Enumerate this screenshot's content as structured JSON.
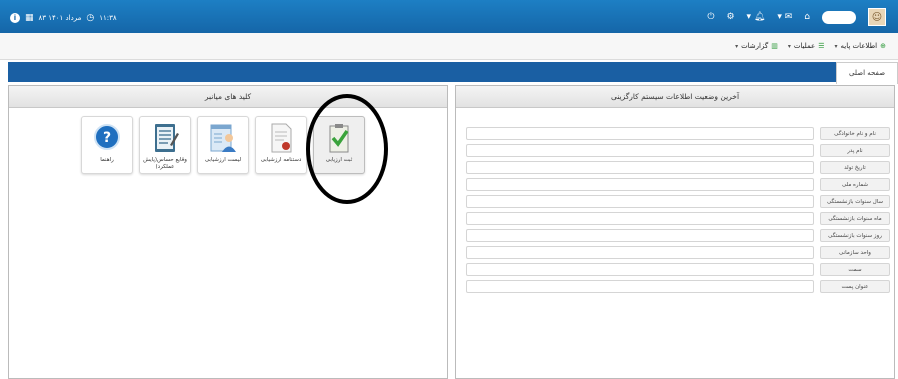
{
  "topbar": {
    "date_text": "۸۳ مرداد ۱۴۰۱",
    "time_text": "۱۱:۳۸",
    "icons": [
      "info-icon",
      "calendar-icon",
      "clock-icon",
      "home-icon",
      "mail-icon",
      "bell-icon",
      "gear-icon",
      "power-icon"
    ]
  },
  "menu": {
    "items": [
      {
        "label": "اطلاعات پایه",
        "icon": "plus-circle-icon"
      },
      {
        "label": "عملیات",
        "icon": "list-icon"
      },
      {
        "label": "گزارشات",
        "icon": "bar-chart-icon"
      }
    ]
  },
  "tabs": {
    "home": "صفحه اصلی"
  },
  "shortcuts": {
    "title": "کلید های میانبر",
    "tiles": [
      {
        "label": "ثبت ارزیابی",
        "icon": "checklist-icon"
      },
      {
        "label": "دستنامه ارزشیابی",
        "icon": "certificate-icon"
      },
      {
        "label": "لیست ارزشیابی",
        "icon": "user-list-icon"
      },
      {
        "label": "وقایع حساس(پایش عملکرد)",
        "icon": "notepad-icon"
      },
      {
        "label": "راهنما",
        "icon": "help-icon"
      }
    ]
  },
  "status": {
    "title": "آخرین وضعیت اطلاعات سیستم کارگزینی",
    "fields": [
      "نام و نام خانوادگی",
      "نام پدر",
      "تاریخ تولد",
      "شماره ملی",
      "سال سنوات بازنشستگی",
      "ماه سنوات بازنشستگی",
      "روز سنوات بازنشستگی",
      "واحد سازمانی",
      "سمت",
      "عنوان پست"
    ]
  },
  "colors": {
    "topbar": "#1566a8",
    "band": "#1a5fa3",
    "accent_green": "#2e9a3a"
  }
}
